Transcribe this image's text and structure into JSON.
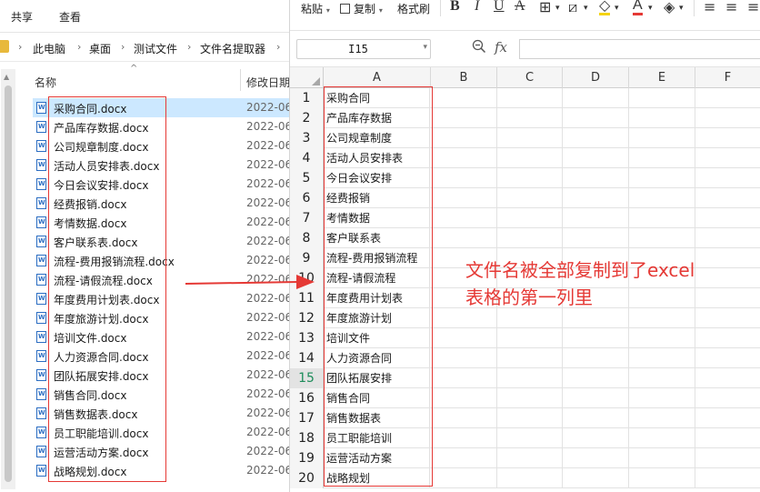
{
  "explorer": {
    "ribbon_tabs": [
      "共享",
      "查看"
    ],
    "breadcrumb": [
      "此电脑",
      "桌面",
      "测试文件",
      "文件名提取器"
    ],
    "columns": {
      "name": "名称",
      "date": "修改日期"
    },
    "files": [
      {
        "name": "采购合同.docx",
        "date": "2022-06"
      },
      {
        "name": "产品库存数据.docx",
        "date": "2022-06"
      },
      {
        "name": "公司规章制度.docx",
        "date": "2022-06"
      },
      {
        "name": "活动人员安排表.docx",
        "date": "2022-06"
      },
      {
        "name": "今日会议安排.docx",
        "date": "2022-06"
      },
      {
        "name": "经费报销.docx",
        "date": "2022-06"
      },
      {
        "name": "考情数据.docx",
        "date": "2022-06"
      },
      {
        "name": "客户联系表.docx",
        "date": "2022-06"
      },
      {
        "name": "流程-费用报销流程.docx",
        "date": "2022-06"
      },
      {
        "name": "流程-请假流程.docx",
        "date": "2022-06"
      },
      {
        "name": "年度费用计划表.docx",
        "date": "2022-06"
      },
      {
        "name": "年度旅游计划.docx",
        "date": "2022-06"
      },
      {
        "name": "培训文件.docx",
        "date": "2022-06"
      },
      {
        "name": "人力资源合同.docx",
        "date": "2022-06"
      },
      {
        "name": "团队拓展安排.docx",
        "date": "2022-06"
      },
      {
        "name": "销售合同.docx",
        "date": "2022-06"
      },
      {
        "name": "销售数据表.docx",
        "date": "2022-06"
      },
      {
        "name": "员工职能培训.docx",
        "date": "2022-06"
      },
      {
        "name": "运营活动方案.docx",
        "date": "2022-06"
      },
      {
        "name": "战略规划.docx",
        "date": "2022-06"
      }
    ]
  },
  "spreadsheet": {
    "toolbar": {
      "paste": "粘贴",
      "copy": "复制",
      "format_painter": "格式刷"
    },
    "name_box": "I15",
    "fx": "fx",
    "columns": [
      "A",
      "B",
      "C",
      "D",
      "E",
      "F"
    ],
    "active_row": 15,
    "rows": [
      {
        "n": "1",
        "a": "采购合同"
      },
      {
        "n": "2",
        "a": "产品库存数据"
      },
      {
        "n": "3",
        "a": "公司规章制度"
      },
      {
        "n": "4",
        "a": "活动人员安排表"
      },
      {
        "n": "5",
        "a": "今日会议安排"
      },
      {
        "n": "6",
        "a": "经费报销"
      },
      {
        "n": "7",
        "a": "考情数据"
      },
      {
        "n": "8",
        "a": "客户联系表"
      },
      {
        "n": "9",
        "a": "流程-费用报销流程"
      },
      {
        "n": "10",
        "a": "流程-请假流程"
      },
      {
        "n": "11",
        "a": "年度费用计划表"
      },
      {
        "n": "12",
        "a": "年度旅游计划"
      },
      {
        "n": "13",
        "a": "培训文件"
      },
      {
        "n": "14",
        "a": "人力资源合同"
      },
      {
        "n": "15",
        "a": "团队拓展安排"
      },
      {
        "n": "16",
        "a": "销售合同"
      },
      {
        "n": "17",
        "a": "销售数据表"
      },
      {
        "n": "18",
        "a": "员工职能培训"
      },
      {
        "n": "19",
        "a": "运营活动方案"
      },
      {
        "n": "20",
        "a": "战略规划"
      }
    ]
  },
  "annotation": {
    "line1": "文件名被全部复制到了excel",
    "line2": "表格的第一列里",
    "color": "#e53935"
  }
}
